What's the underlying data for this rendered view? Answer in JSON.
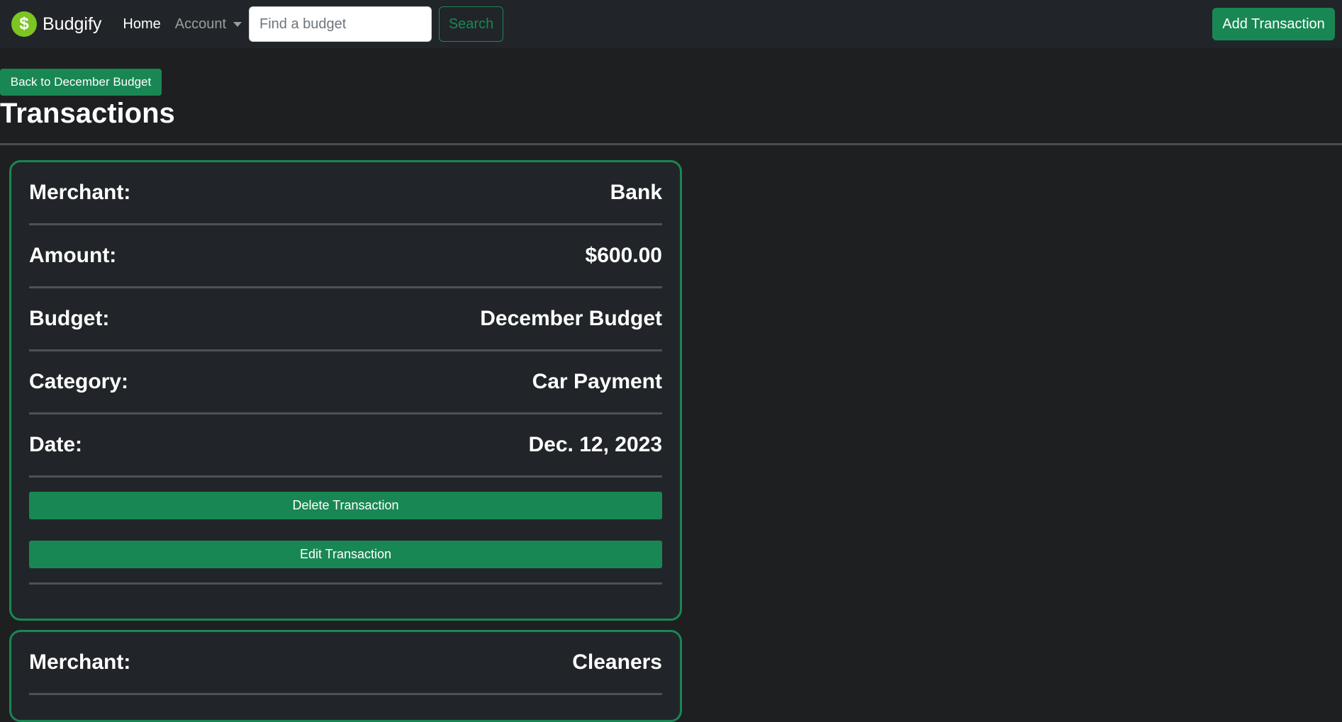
{
  "navbar": {
    "brand_icon": "$",
    "brand_name": "Budgify",
    "home_label": "Home",
    "account_label": "Account",
    "search_placeholder": "Find a budget",
    "search_value": "",
    "search_label": "Search",
    "add_label": "Add Transaction"
  },
  "page": {
    "back_label": "Back to December Budget",
    "title": "Transactions"
  },
  "transactions": [
    {
      "rows": [
        {
          "label": "Merchant:",
          "value": "Bank"
        },
        {
          "label": "Amount:",
          "value": "$600.00"
        },
        {
          "label": "Budget:",
          "value": "December Budget"
        },
        {
          "label": "Category:",
          "value": "Car Payment"
        },
        {
          "label": "Date:",
          "value": "Dec. 12, 2023"
        }
      ],
      "delete_label": "Delete Transaction",
      "edit_label": "Edit Transaction"
    },
    {
      "rows": [
        {
          "label": "Merchant:",
          "value": "Cleaners"
        }
      ]
    }
  ],
  "colors": {
    "accent": "#198754",
    "logo": "#7cc522",
    "background": "#1e1f21",
    "navbar": "#212529"
  }
}
